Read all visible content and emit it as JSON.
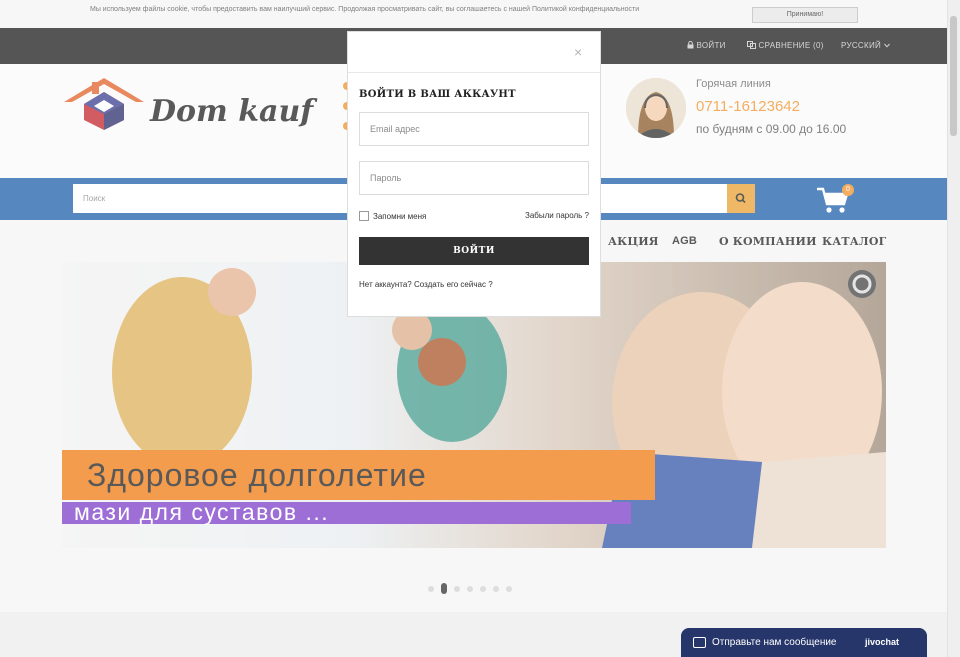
{
  "cookie": {
    "text": "Мы используем файлы cookie, чтобы предоставить вам наилучший сервис. Продолжая просматривать сайт, вы соглашаетесь с нашей Политикой конфиденциальности",
    "accept_label": "Принимаю!"
  },
  "topbar": {
    "login_label": "ВОЙТИ",
    "compare_label": "СРАВНЕНИЕ (0)",
    "language_label": "РУССКИЙ"
  },
  "header": {
    "logo_text": "Dom kauf",
    "hotline_label": "Горячая линия",
    "phone": "0711-16123642",
    "hours": "по будням с 09.00 до 16.00"
  },
  "search": {
    "placeholder": "Поиск"
  },
  "cart": {
    "count": "0"
  },
  "nav": {
    "items": [
      {
        "label": "АКЦИЯ"
      },
      {
        "label": "AGB"
      },
      {
        "label": "О КОМПАНИИ"
      },
      {
        "label": "КАТАЛОГ"
      }
    ]
  },
  "banner": {
    "title": "Здоровое долголетие",
    "subtitle": "мази для суставов ...",
    "slide_count": 7,
    "active_slide": 2
  },
  "login_modal": {
    "close_glyph": "×",
    "title": "ВОЙТИ В ВАШ АККАУНТ",
    "email_placeholder": "Email адрес",
    "password_placeholder": "Пароль",
    "remember_label": "Запомни меня",
    "forgot_label": "Забыли пароль ?",
    "submit_label": "ВОЙТИ",
    "create_label": "Нет аккаунта? Создать его сейчас ?"
  },
  "chat": {
    "message_label": "Отправьте нам сообщение",
    "brand": "jivochat"
  },
  "colors": {
    "accent_orange": "#f0922b",
    "search_blue": "#1e5fa8",
    "topbar_dark": "#1c1c1c",
    "chat_navy": "#26356a"
  }
}
